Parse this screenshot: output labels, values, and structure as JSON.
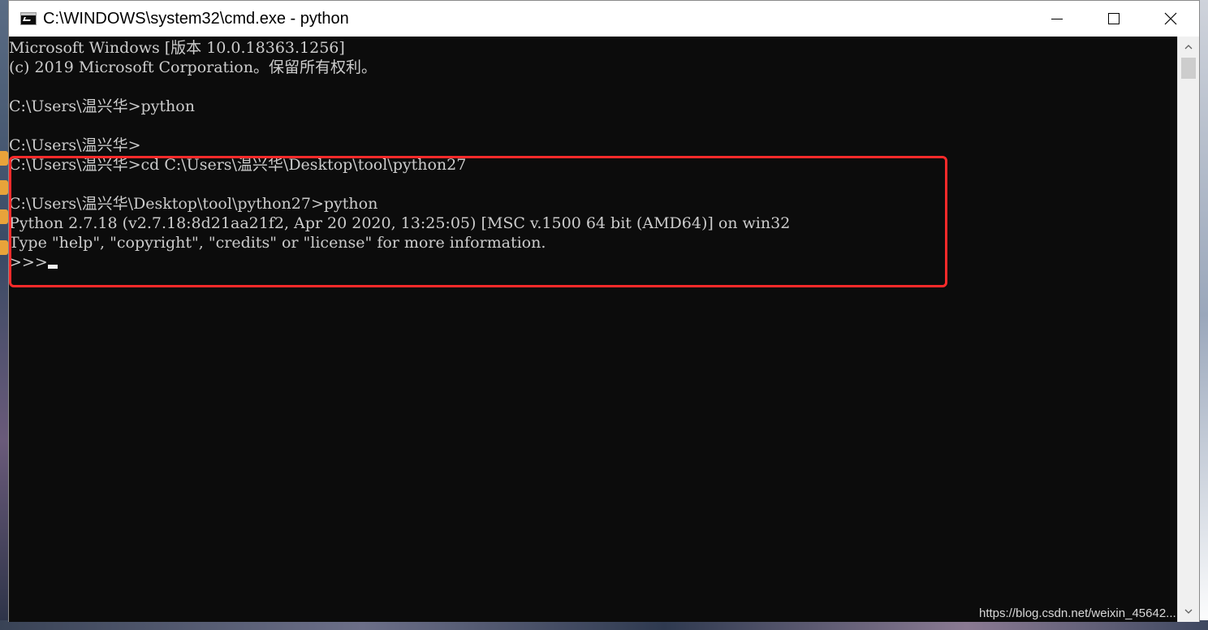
{
  "window": {
    "title": "C:\\WINDOWS\\system32\\cmd.exe - python"
  },
  "console": {
    "lines": [
      "Microsoft Windows [版本 10.0.18363.1256]",
      "(c) 2019 Microsoft Corporation。保留所有权利。",
      "",
      "C:\\Users\\温兴华>python",
      "",
      "C:\\Users\\温兴华>",
      "C:\\Users\\温兴华>cd C:\\Users\\温兴华\\Desktop\\tool\\python27",
      "",
      "C:\\Users\\温兴华\\Desktop\\tool\\python27>python",
      "Python 2.7.18 (v2.7.18:8d21aa21f2, Apr 20 2020, 13:25:05) [MSC v.1500 64 bit (AMD64)] on win32",
      "Type \"help\", \"copyright\", \"credits\" or \"license\" for more information.",
      ">>> "
    ]
  },
  "watermark": "https://blog.csdn.net/weixin_45642...",
  "colors": {
    "console_bg": "#0c0c0c",
    "console_text": "#cccccc",
    "highlight": "#ff2a2a",
    "titlebar_bg": "#ffffff"
  },
  "icons": {
    "app": "cmd-icon",
    "minimize": "minimize-icon",
    "maximize": "maximize-icon",
    "close": "close-icon",
    "scroll_up": "scroll-up-arrow-icon",
    "scroll_down": "scroll-down-arrow-icon"
  }
}
